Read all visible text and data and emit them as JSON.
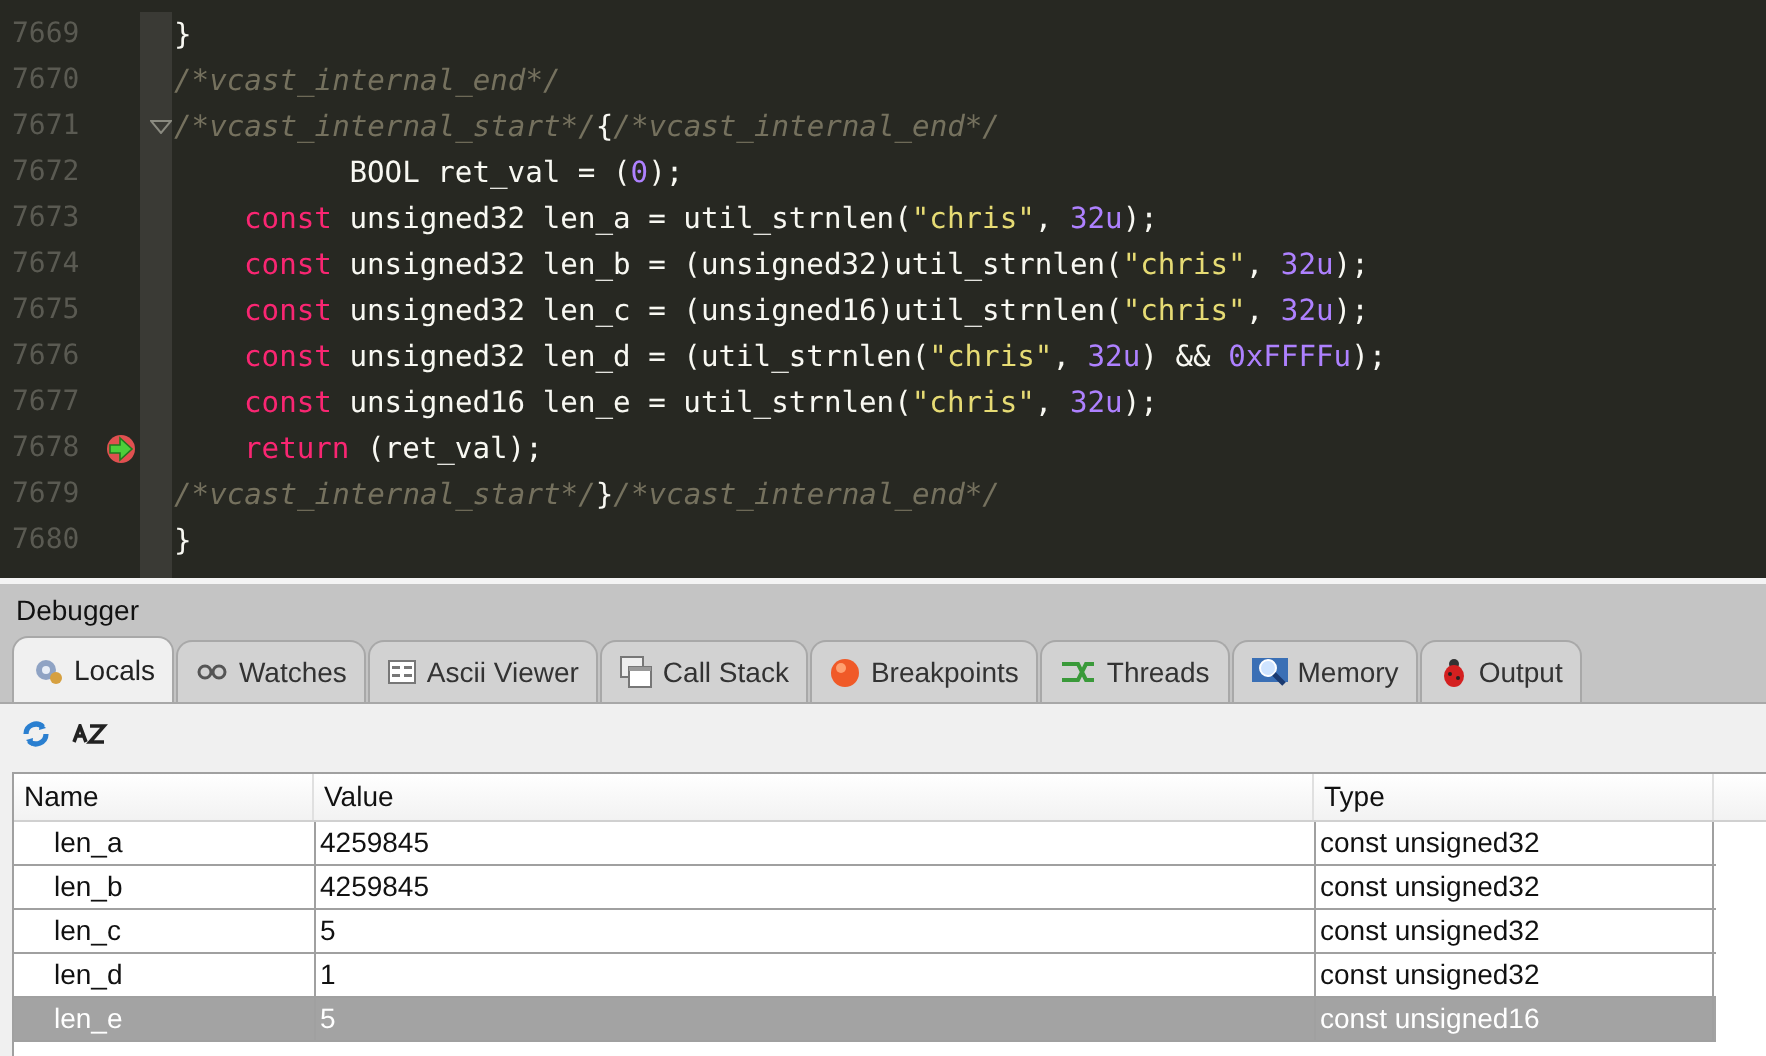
{
  "editor": {
    "lines": [
      {
        "number": "7669",
        "kind": "top",
        "fold": false,
        "current": false,
        "tokens": [
          {
            "kind": "plain",
            "text": "}"
          }
        ]
      },
      {
        "number": "7670",
        "kind": "top",
        "fold": false,
        "current": false,
        "tokens": [
          {
            "kind": "comment",
            "text": "/*vcast_internal_end*/"
          }
        ]
      },
      {
        "number": "7671",
        "kind": "top",
        "fold": true,
        "current": false,
        "tokens": [
          {
            "kind": "comment",
            "text": "/*vcast_internal_start*/"
          },
          {
            "kind": "plain",
            "text": "{"
          },
          {
            "kind": "comment",
            "text": "/*vcast_internal_end*/"
          }
        ]
      },
      {
        "number": "7672",
        "kind": "body",
        "fold": false,
        "current": false,
        "tokens": [
          {
            "kind": "plain",
            "text": "      BOOL ret_val = ("
          },
          {
            "kind": "number",
            "text": "0"
          },
          {
            "kind": "plain",
            "text": ");"
          }
        ]
      },
      {
        "number": "7673",
        "kind": "body",
        "fold": false,
        "current": false,
        "tokens": [
          {
            "kind": "keyword",
            "text": "const"
          },
          {
            "kind": "plain",
            "text": " unsigned32 len_a = util_strnlen("
          },
          {
            "kind": "string",
            "text": "\"chris\""
          },
          {
            "kind": "plain",
            "text": ", "
          },
          {
            "kind": "number",
            "text": "32u"
          },
          {
            "kind": "plain",
            "text": ");"
          }
        ]
      },
      {
        "number": "7674",
        "kind": "body",
        "fold": false,
        "current": false,
        "tokens": [
          {
            "kind": "keyword",
            "text": "const"
          },
          {
            "kind": "plain",
            "text": " unsigned32 len_b = (unsigned32)util_strnlen("
          },
          {
            "kind": "string",
            "text": "\"chris\""
          },
          {
            "kind": "plain",
            "text": ", "
          },
          {
            "kind": "number",
            "text": "32u"
          },
          {
            "kind": "plain",
            "text": ");"
          }
        ]
      },
      {
        "number": "7675",
        "kind": "body",
        "fold": false,
        "current": false,
        "tokens": [
          {
            "kind": "keyword",
            "text": "const"
          },
          {
            "kind": "plain",
            "text": " unsigned32 len_c = (unsigned16)util_strnlen("
          },
          {
            "kind": "string",
            "text": "\"chris\""
          },
          {
            "kind": "plain",
            "text": ", "
          },
          {
            "kind": "number",
            "text": "32u"
          },
          {
            "kind": "plain",
            "text": ");"
          }
        ]
      },
      {
        "number": "7676",
        "kind": "body",
        "fold": false,
        "current": false,
        "tokens": [
          {
            "kind": "keyword",
            "text": "const"
          },
          {
            "kind": "plain",
            "text": " unsigned32 len_d = (util_strnlen("
          },
          {
            "kind": "string",
            "text": "\"chris\""
          },
          {
            "kind": "plain",
            "text": ", "
          },
          {
            "kind": "number",
            "text": "32u"
          },
          {
            "kind": "plain",
            "text": ") && "
          },
          {
            "kind": "number",
            "text": "0xFFFFu"
          },
          {
            "kind": "plain",
            "text": ");"
          }
        ]
      },
      {
        "number": "7677",
        "kind": "body",
        "fold": false,
        "current": false,
        "tokens": [
          {
            "kind": "keyword",
            "text": "const"
          },
          {
            "kind": "plain",
            "text": " unsigned16 len_e = util_strnlen("
          },
          {
            "kind": "string",
            "text": "\"chris\""
          },
          {
            "kind": "plain",
            "text": ", "
          },
          {
            "kind": "number",
            "text": "32u"
          },
          {
            "kind": "plain",
            "text": ");"
          }
        ]
      },
      {
        "number": "7678",
        "kind": "body",
        "fold": false,
        "current": true,
        "tokens": [
          {
            "kind": "keyword",
            "text": "return"
          },
          {
            "kind": "plain",
            "text": " (ret_val);"
          }
        ]
      },
      {
        "number": "7679",
        "kind": "top",
        "fold": false,
        "current": false,
        "tokens": [
          {
            "kind": "comment",
            "text": "/*vcast_internal_start*/"
          },
          {
            "kind": "plain",
            "text": "}"
          },
          {
            "kind": "comment",
            "text": "/*vcast_internal_end*/"
          }
        ]
      },
      {
        "number": "7680",
        "kind": "top",
        "fold": false,
        "current": false,
        "tokens": [
          {
            "kind": "plain",
            "text": "}"
          }
        ]
      }
    ]
  },
  "debugger": {
    "title": "Debugger",
    "tabs": [
      {
        "label": "Locals",
        "selected": true
      },
      {
        "label": "Watches",
        "selected": false
      },
      {
        "label": "Ascii Viewer",
        "selected": false
      },
      {
        "label": "Call Stack",
        "selected": false
      },
      {
        "label": "Breakpoints",
        "selected": false
      },
      {
        "label": "Threads",
        "selected": false
      },
      {
        "label": "Memory",
        "selected": false
      },
      {
        "label": "Output",
        "selected": false
      }
    ],
    "table": {
      "columns": [
        "Name",
        "Value",
        "Type"
      ],
      "rows": [
        {
          "name": "len_a",
          "value": "4259845",
          "type": "const unsigned32",
          "selected": false
        },
        {
          "name": "len_b",
          "value": "4259845",
          "type": "const unsigned32",
          "selected": false
        },
        {
          "name": "len_c",
          "value": "5",
          "type": "const unsigned32",
          "selected": false
        },
        {
          "name": "len_d",
          "value": "1",
          "type": "const unsigned32",
          "selected": false
        },
        {
          "name": "len_e",
          "value": "5",
          "type": "const unsigned16",
          "selected": true
        }
      ]
    }
  }
}
